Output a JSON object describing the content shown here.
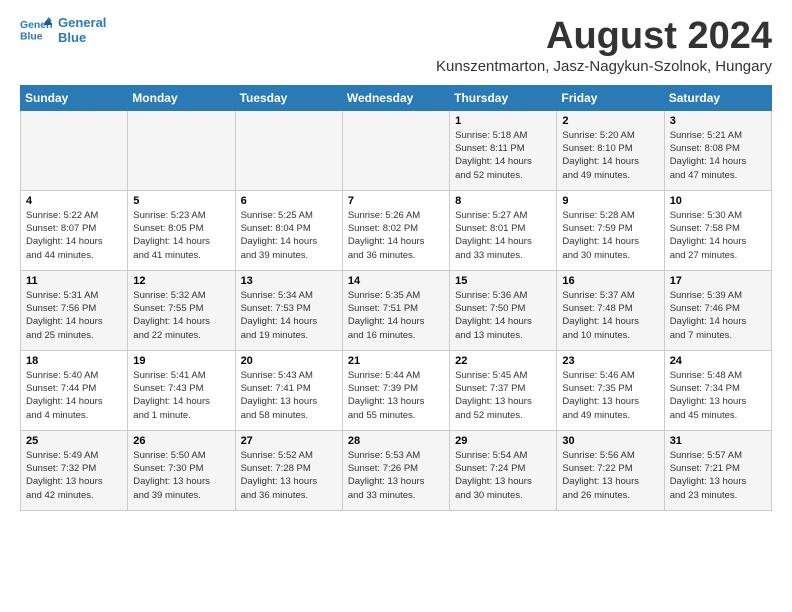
{
  "header": {
    "logo_line1": "General",
    "logo_line2": "Blue",
    "month_year": "August 2024",
    "location": "Kunszentmarton, Jasz-Nagykun-Szolnok, Hungary"
  },
  "weekdays": [
    "Sunday",
    "Monday",
    "Tuesday",
    "Wednesday",
    "Thursday",
    "Friday",
    "Saturday"
  ],
  "weeks": [
    [
      {
        "day": "",
        "info": ""
      },
      {
        "day": "",
        "info": ""
      },
      {
        "day": "",
        "info": ""
      },
      {
        "day": "",
        "info": ""
      },
      {
        "day": "1",
        "info": "Sunrise: 5:18 AM\nSunset: 8:11 PM\nDaylight: 14 hours\nand 52 minutes."
      },
      {
        "day": "2",
        "info": "Sunrise: 5:20 AM\nSunset: 8:10 PM\nDaylight: 14 hours\nand 49 minutes."
      },
      {
        "day": "3",
        "info": "Sunrise: 5:21 AM\nSunset: 8:08 PM\nDaylight: 14 hours\nand 47 minutes."
      }
    ],
    [
      {
        "day": "4",
        "info": "Sunrise: 5:22 AM\nSunset: 8:07 PM\nDaylight: 14 hours\nand 44 minutes."
      },
      {
        "day": "5",
        "info": "Sunrise: 5:23 AM\nSunset: 8:05 PM\nDaylight: 14 hours\nand 41 minutes."
      },
      {
        "day": "6",
        "info": "Sunrise: 5:25 AM\nSunset: 8:04 PM\nDaylight: 14 hours\nand 39 minutes."
      },
      {
        "day": "7",
        "info": "Sunrise: 5:26 AM\nSunset: 8:02 PM\nDaylight: 14 hours\nand 36 minutes."
      },
      {
        "day": "8",
        "info": "Sunrise: 5:27 AM\nSunset: 8:01 PM\nDaylight: 14 hours\nand 33 minutes."
      },
      {
        "day": "9",
        "info": "Sunrise: 5:28 AM\nSunset: 7:59 PM\nDaylight: 14 hours\nand 30 minutes."
      },
      {
        "day": "10",
        "info": "Sunrise: 5:30 AM\nSunset: 7:58 PM\nDaylight: 14 hours\nand 27 minutes."
      }
    ],
    [
      {
        "day": "11",
        "info": "Sunrise: 5:31 AM\nSunset: 7:56 PM\nDaylight: 14 hours\nand 25 minutes."
      },
      {
        "day": "12",
        "info": "Sunrise: 5:32 AM\nSunset: 7:55 PM\nDaylight: 14 hours\nand 22 minutes."
      },
      {
        "day": "13",
        "info": "Sunrise: 5:34 AM\nSunset: 7:53 PM\nDaylight: 14 hours\nand 19 minutes."
      },
      {
        "day": "14",
        "info": "Sunrise: 5:35 AM\nSunset: 7:51 PM\nDaylight: 14 hours\nand 16 minutes."
      },
      {
        "day": "15",
        "info": "Sunrise: 5:36 AM\nSunset: 7:50 PM\nDaylight: 14 hours\nand 13 minutes."
      },
      {
        "day": "16",
        "info": "Sunrise: 5:37 AM\nSunset: 7:48 PM\nDaylight: 14 hours\nand 10 minutes."
      },
      {
        "day": "17",
        "info": "Sunrise: 5:39 AM\nSunset: 7:46 PM\nDaylight: 14 hours\nand 7 minutes."
      }
    ],
    [
      {
        "day": "18",
        "info": "Sunrise: 5:40 AM\nSunset: 7:44 PM\nDaylight: 14 hours\nand 4 minutes."
      },
      {
        "day": "19",
        "info": "Sunrise: 5:41 AM\nSunset: 7:43 PM\nDaylight: 14 hours\nand 1 minute."
      },
      {
        "day": "20",
        "info": "Sunrise: 5:43 AM\nSunset: 7:41 PM\nDaylight: 13 hours\nand 58 minutes."
      },
      {
        "day": "21",
        "info": "Sunrise: 5:44 AM\nSunset: 7:39 PM\nDaylight: 13 hours\nand 55 minutes."
      },
      {
        "day": "22",
        "info": "Sunrise: 5:45 AM\nSunset: 7:37 PM\nDaylight: 13 hours\nand 52 minutes."
      },
      {
        "day": "23",
        "info": "Sunrise: 5:46 AM\nSunset: 7:35 PM\nDaylight: 13 hours\nand 49 minutes."
      },
      {
        "day": "24",
        "info": "Sunrise: 5:48 AM\nSunset: 7:34 PM\nDaylight: 13 hours\nand 45 minutes."
      }
    ],
    [
      {
        "day": "25",
        "info": "Sunrise: 5:49 AM\nSunset: 7:32 PM\nDaylight: 13 hours\nand 42 minutes."
      },
      {
        "day": "26",
        "info": "Sunrise: 5:50 AM\nSunset: 7:30 PM\nDaylight: 13 hours\nand 39 minutes."
      },
      {
        "day": "27",
        "info": "Sunrise: 5:52 AM\nSunset: 7:28 PM\nDaylight: 13 hours\nand 36 minutes."
      },
      {
        "day": "28",
        "info": "Sunrise: 5:53 AM\nSunset: 7:26 PM\nDaylight: 13 hours\nand 33 minutes."
      },
      {
        "day": "29",
        "info": "Sunrise: 5:54 AM\nSunset: 7:24 PM\nDaylight: 13 hours\nand 30 minutes."
      },
      {
        "day": "30",
        "info": "Sunrise: 5:56 AM\nSunset: 7:22 PM\nDaylight: 13 hours\nand 26 minutes."
      },
      {
        "day": "31",
        "info": "Sunrise: 5:57 AM\nSunset: 7:21 PM\nDaylight: 13 hours\nand 23 minutes."
      }
    ]
  ]
}
